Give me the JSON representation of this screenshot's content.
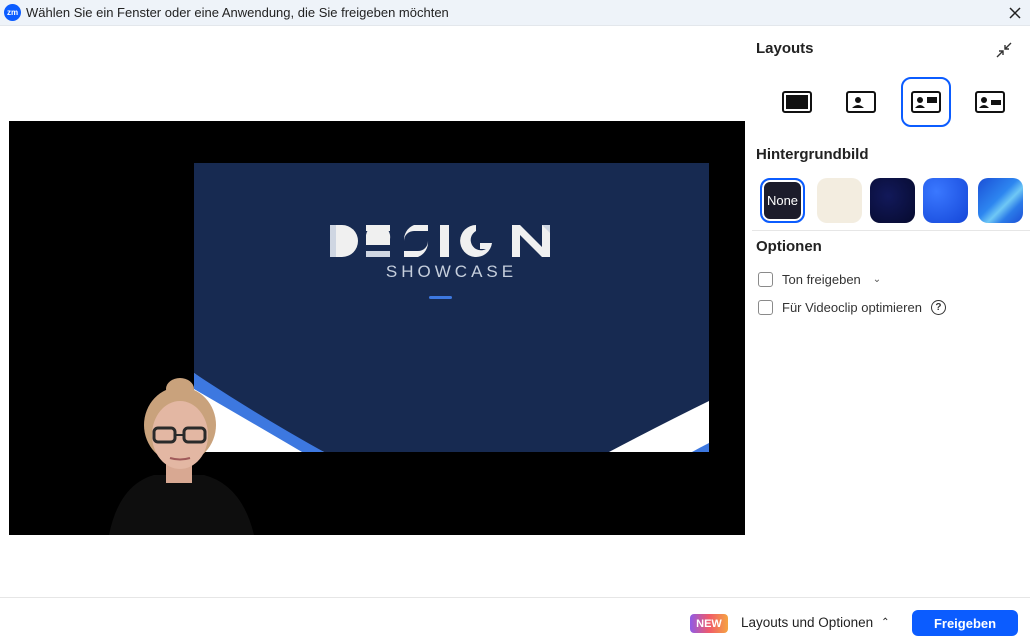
{
  "window": {
    "title": "Wählen Sie ein Fenster oder eine Anwendung, die Sie freigeben möchten",
    "app_icon_text": "zm"
  },
  "preview": {
    "slide_logo_text": "DESIGN",
    "slide_subtitle": "SHOWCASE"
  },
  "side_panel": {
    "layouts_title": "Layouts",
    "layout_options": [
      {
        "icon": "fullscreen-layout-icon",
        "selected": false
      },
      {
        "icon": "picture-layout-icon",
        "selected": false
      },
      {
        "icon": "side-by-side-layout-icon",
        "selected": true
      },
      {
        "icon": "standard-layout-icon",
        "selected": false
      }
    ],
    "background_title": "Hintergrundbild",
    "backgrounds": [
      {
        "label": "None",
        "selected": true
      },
      {
        "color": "#f3ede0"
      },
      {
        "color": "#0a0f3d"
      },
      {
        "color": "#1f5ff0"
      },
      {
        "color": "#2b7be8"
      }
    ],
    "options_title": "Optionen",
    "options": [
      {
        "label": "Ton freigeben",
        "checked": false
      },
      {
        "label": "Für Videoclip optimieren",
        "checked": false
      }
    ]
  },
  "footer": {
    "new_badge": "NEW",
    "layouts_options_label": "Layouts und Optionen",
    "share_button": "Freigeben"
  },
  "colors": {
    "accent": "#0b5cff",
    "slide_background": "#172a51"
  }
}
